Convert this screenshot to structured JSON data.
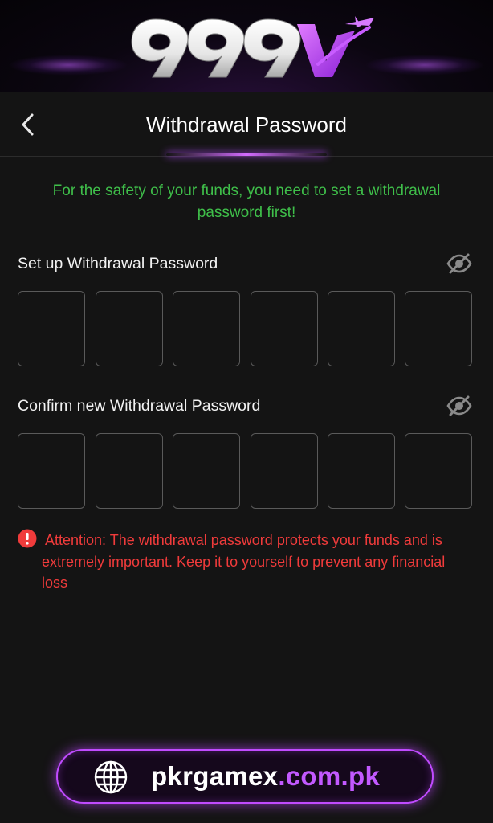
{
  "brand": {
    "logo_text": "999V",
    "accent_color": "#c04bff"
  },
  "header": {
    "title": "Withdrawal Password",
    "back_icon": "chevron-left-icon"
  },
  "notice": {
    "text": "For the safety of your funds, you need to set a withdrawal password first!",
    "color": "#3fbf4a"
  },
  "setup_field": {
    "label": "Set up Withdrawal Password",
    "digits": [
      "",
      "",
      "",
      "",
      "",
      ""
    ],
    "visibility_icon": "eye-off-icon"
  },
  "confirm_field": {
    "label": "Confirm new Withdrawal Password",
    "digits": [
      "",
      "",
      "",
      "",
      "",
      ""
    ],
    "visibility_icon": "eye-off-icon"
  },
  "attention": {
    "icon": "alert-circle-icon",
    "text": "Attention: The withdrawal password protects your funds and is extremely important. Keep it to yourself to prevent any financial loss",
    "color": "#f03b3b"
  },
  "site_badge": {
    "icon": "globe-icon",
    "url_main": "pkrgamex",
    "url_tld": ".com.pk"
  }
}
